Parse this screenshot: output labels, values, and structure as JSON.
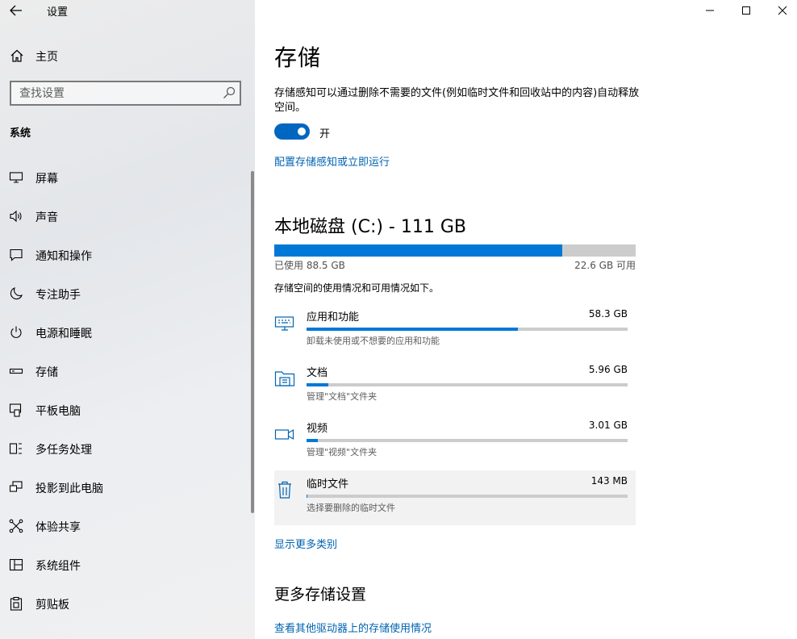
{
  "window": {
    "title": "设置"
  },
  "sidebar": {
    "home_label": "主页",
    "search_placeholder": "查找设置",
    "section_label": "系统",
    "items": [
      {
        "label": "屏幕",
        "icon": "display-icon"
      },
      {
        "label": "声音",
        "icon": "speaker-icon"
      },
      {
        "label": "通知和操作",
        "icon": "notification-icon"
      },
      {
        "label": "专注助手",
        "icon": "moon-icon"
      },
      {
        "label": "电源和睡眠",
        "icon": "power-icon"
      },
      {
        "label": "存储",
        "icon": "storage-icon",
        "selected": true
      },
      {
        "label": "平板电脑",
        "icon": "tablet-icon"
      },
      {
        "label": "多任务处理",
        "icon": "multitasking-icon"
      },
      {
        "label": "投影到此电脑",
        "icon": "projecting-icon"
      },
      {
        "label": "体验共享",
        "icon": "shared-experiences-icon"
      },
      {
        "label": "系统组件",
        "icon": "system-components-icon"
      },
      {
        "label": "剪贴板",
        "icon": "clipboard-icon"
      }
    ]
  },
  "main": {
    "title": "存储",
    "description": "存储感知可以通过删除不需要的文件(例如临时文件和回收站中的内容)自动释放空间。",
    "toggle_state": "开",
    "configure_link": "配置存储感知或立即运行",
    "disk": {
      "title": "本地磁盘 (C:) - 111 GB",
      "used_label": "已使用 88.5 GB",
      "free_label": "22.6 GB 可用",
      "used_fraction": 0.797,
      "usage_desc": "存储空间的使用情况和可用情况如下。"
    },
    "categories": [
      {
        "name": "应用和功能",
        "size": "58.3 GB",
        "sub": "卸载未使用或不想要的应用和功能",
        "icon": "apps-icon",
        "fraction": 0.658
      },
      {
        "name": "文档",
        "size": "5.96 GB",
        "sub": "管理\"文档\"文件夹",
        "icon": "documents-icon",
        "fraction": 0.067
      },
      {
        "name": "视频",
        "size": "3.01 GB",
        "sub": "管理\"视频\"文件夹",
        "icon": "video-icon",
        "fraction": 0.034
      },
      {
        "name": "临时文件",
        "size": "143 MB",
        "sub": "选择要删除的临时文件",
        "icon": "trash-icon",
        "fraction": 0.002
      }
    ],
    "show_more_link": "显示更多类别",
    "more_title": "更多存储设置",
    "other_drives_link": "查看其他驱动器上的存储使用情况"
  },
  "colors": {
    "accent": "#0078d7",
    "link": "#0063b1",
    "toggle_on": "#0067c0",
    "bar_bg": "#cccccc"
  }
}
